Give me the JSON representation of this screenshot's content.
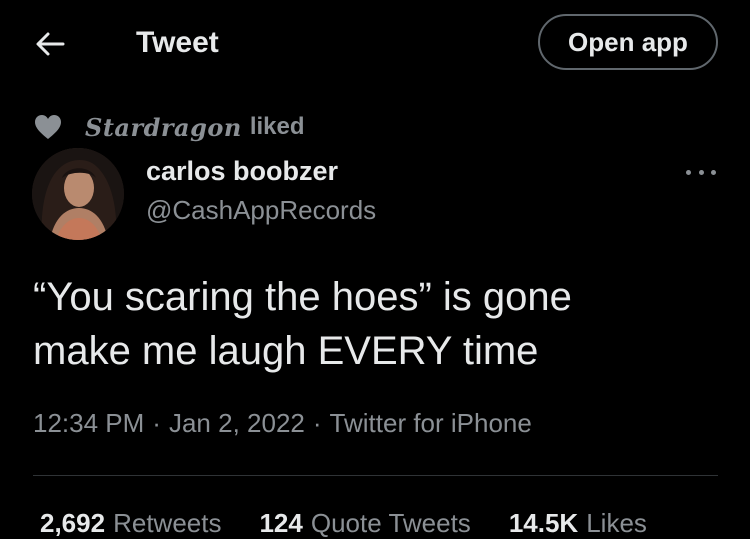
{
  "header": {
    "title": "Tweet",
    "back_icon": "arrow-left-icon",
    "open_app_label": "Open app"
  },
  "social_context": {
    "icon": "heart-icon",
    "liker": "Stardragon",
    "action": "liked"
  },
  "author": {
    "display_name": "carlos boobzer",
    "handle": "@CashAppRecords",
    "more_icon": "more-dots-icon"
  },
  "tweet": {
    "text": "“You scaring the hoes” is gone\nmake me laugh EVERY time",
    "time": "12:34 PM",
    "date": "Jan 2, 2022",
    "source": "Twitter for iPhone",
    "separator": "·"
  },
  "stats": [
    {
      "count": "2,692",
      "label": "Retweets"
    },
    {
      "count": "124",
      "label": "Quote Tweets"
    },
    {
      "count": "14.5K",
      "label": "Likes"
    }
  ],
  "colors": {
    "background": "#000000",
    "text_primary": "#e7e9ea",
    "text_secondary": "#8b9095",
    "divider": "#2f3336",
    "button_border": "#60676d"
  }
}
